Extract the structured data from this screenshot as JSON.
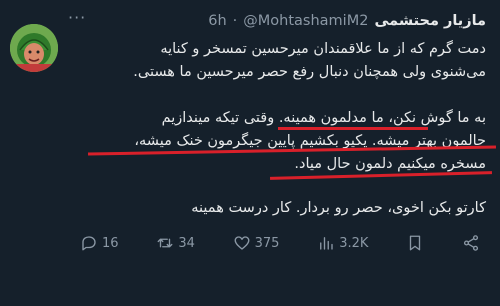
{
  "author": {
    "display_name": "مازیار محتشمی",
    "handle": "@MohtashamiM2",
    "separator": "·",
    "time": "6h"
  },
  "more_label": "···",
  "body_lines": [
    "دمت گرم که از ما علاقمندان میرحسین تمسخر و کنایه",
    "می‌شنوی ولی همچنان دنبال رفع حصر میرحسین ما هستی.",
    "به ما گوش نکن، ما مدلمون همینه. وقتی تیکه میندازیم",
    "حالمون بهتر میشه. یکیو بکشیم پایین جیگرمون خنک میشه،",
    "مسخره میکنیم دلمون حال میاد.",
    "کارتو بکن اخوی، حصر رو بردار. کار درست همینه"
  ],
  "actions": {
    "reply_count": "16",
    "retweet_count": "34",
    "like_count": "375",
    "views_count": "3.2K"
  },
  "colors": {
    "background": "#15202b",
    "text": "#e7e9ea",
    "muted": "#8b98a5",
    "underline": "#d9202a"
  },
  "icons": [
    "reply-icon",
    "retweet-icon",
    "like-icon",
    "views-icon",
    "bookmark-icon",
    "share-icon",
    "more-icon"
  ]
}
